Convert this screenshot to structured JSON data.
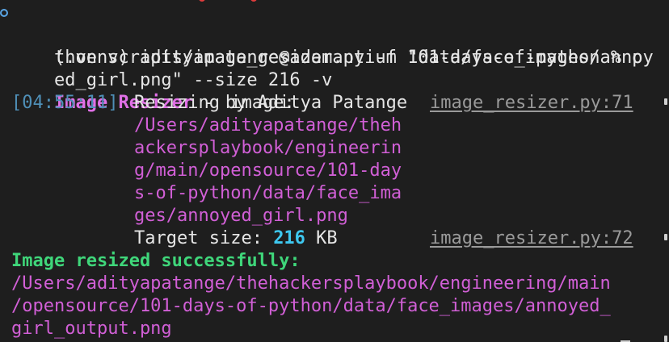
{
  "terminal": {
    "prompt": {
      "line1": "(.venv) adityapatange@adamantium 101-days-of-python % py",
      "line2": "thon scripts/image_resizer.py -f \"data/face_images/anno",
      "line3": "ed_girl.png\" --size 216 -v"
    },
    "banner": {
      "title": "Image Resizer",
      "byline": " - by Aditya Patange"
    },
    "log1": {
      "timestamp": "[04:55:11]",
      "message": "Resizing image:",
      "source": "image_resizer.py:71",
      "path_lines": [
        "/Users/adityapatange/theh",
        "ackersplaybook/engineerin",
        "g/main/opensource/101-day",
        "s-of-python/data/face_ima",
        "ges/annoyed_girl.png"
      ]
    },
    "log2": {
      "label": "Target size: ",
      "value": "216",
      "unit": " KB",
      "source": "image_resizer.py:72"
    },
    "result": {
      "message": "Image resized successfully:",
      "path_lines": [
        "/Users/adityapatange/thehackersplaybook/engineering/main",
        "/opensource/101-days-of-python/data/face_images/annoyed_",
        "girl_output.png"
      ]
    }
  },
  "colors": {
    "background": "#1e1e1e",
    "text": "#e6e6e6",
    "magenta": "#d15fd6",
    "green": "#3fd67a",
    "cyan": "#3ec8f0",
    "timestamp": "#4f8fb7",
    "source_link": "#9a9a9a"
  }
}
